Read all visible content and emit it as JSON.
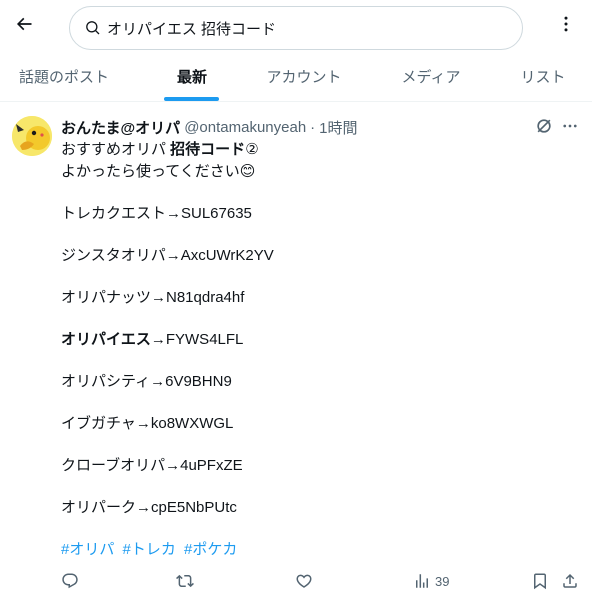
{
  "search": {
    "query": "オリパイエス 招待コード"
  },
  "tabs": [
    {
      "label": "話題のポスト"
    },
    {
      "label": "最新"
    },
    {
      "label": "アカウント"
    },
    {
      "label": "メディア"
    },
    {
      "label": "リスト"
    }
  ],
  "tweet": {
    "display_name": "おんたま@オリパ",
    "handle": "@ontamakunyeah",
    "separator": "·",
    "time": "1時間",
    "line1_prefix": "おすすめオリパ ",
    "line1_bold": "招待コード",
    "line1_suffix": "②",
    "line2": "よかったら使ってください😊",
    "codes": [
      "トレカクエスト→SUL67635",
      "ジンスタオリパ→AxcUWrK2YV",
      "オリパナッツ→N81qdra4hf"
    ],
    "bold_code_name": "オリパイエス",
    "bold_code_value": "→FYWS4LFL",
    "codes2": [
      "オリパシティ→6V9BHN9",
      "イブガチャ→ko8WXWGL",
      "クローブオリパ→4uPFxZE",
      "オリパーク→cpE5NbPUtc"
    ],
    "hashtags": [
      "#オリパ",
      "#トレカ",
      "#ポケカ"
    ],
    "views": "39"
  },
  "colors": {
    "accent": "#1d9bf0",
    "secondary_text": "#536471",
    "primary_text": "#0f1419"
  }
}
